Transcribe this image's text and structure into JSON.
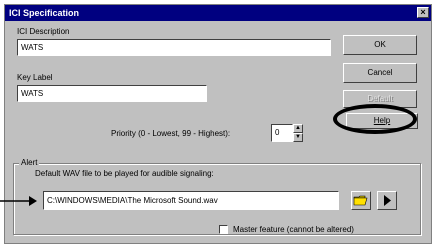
{
  "dialog": {
    "title": "ICI Specification",
    "close_label": "×"
  },
  "fields": {
    "ici_description_label": "ICI Description",
    "ici_description_value": "WATS",
    "key_label_label": "Key Label",
    "key_label_value": "WATS",
    "priority_label": "Priority (0 - Lowest, 99 - Highest):",
    "priority_value": "0"
  },
  "buttons": {
    "ok": "OK",
    "cancel": "Cancel",
    "disabled": "Default",
    "help": "Help"
  },
  "alert": {
    "group_label": "Alert",
    "wav_label": "Default WAV file to be played for audible signaling:",
    "wav_value": "C:\\WINDOWS\\MEDIA\\The Microsoft Sound.wav",
    "master_label": "Master feature (cannot be altered)"
  },
  "icons": {
    "browse": "folder-icon",
    "play": "play-icon",
    "arrow": "arrow-right-icon"
  },
  "colors": {
    "titlebar": "#000080",
    "dialog_bg": "#c0c0c0",
    "annotation": "#000000"
  }
}
